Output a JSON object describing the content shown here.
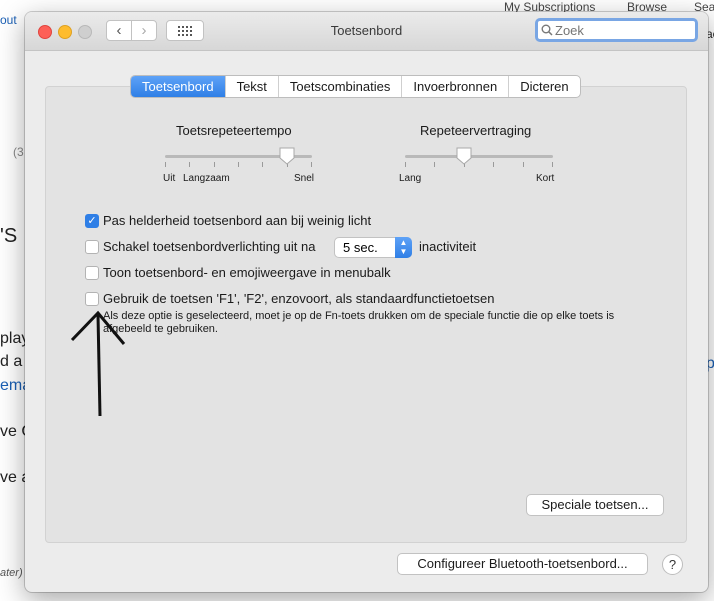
{
  "background": {
    "links_top": [
      "out",
      "My Subscriptions",
      "Browse",
      "Sea"
    ],
    "fragments": [
      "ac",
      "(3",
      "'S",
      "play",
      "d a",
      "ema",
      "ve C",
      "ve a",
      "ater)",
      "p"
    ]
  },
  "window": {
    "title": "Toetsenbord",
    "search_placeholder": "Zoek",
    "tabs": [
      "Toetsenbord",
      "Tekst",
      "Toetscombinaties",
      "Invoerbronnen",
      "Dicteren"
    ],
    "active_tab": 0,
    "key_repeat": {
      "label": "Toetsrepeteertempo",
      "left_label": "Uit",
      "left_label2": "Langzaam",
      "right_label": "Snel",
      "level": 0.83
    },
    "repeat_delay": {
      "label": "Repeteervertraging",
      "left_label": "Lang",
      "right_label": "Kort",
      "level": 0.4
    },
    "options": {
      "brightness": {
        "label": "Pas helderheid toetsenbord aan bij weinig licht",
        "checked": true
      },
      "backlight": {
        "label": "Schakel toetsenbordverlichting uit na",
        "checked": false,
        "select_value": "5 sec.",
        "suffix": "inactiviteit"
      },
      "menubar": {
        "label": "Toon toetsenbord- en emojiweergave in menubalk",
        "checked": false
      },
      "fkeys": {
        "label": "Gebruik de toetsen 'F1', 'F2', enzovoort, als standaardfunctietoetsen",
        "checked": false,
        "note_line1": "Als deze optie is geselecteerd, moet je op de Fn-toets drukken om de speciale functie die op elke toets is",
        "note_line2": "afgebeeld te gebruiken."
      }
    },
    "special_keys_button": "Speciale toetsen...",
    "bluetooth_button": "Configureer Bluetooth-toetsenbord...",
    "help_label": "?"
  },
  "colors": {
    "accent": "#2f7fe6",
    "close": "#fd5f57",
    "minimize": "#febc2e",
    "zoom": "#c8c8c8",
    "link": "#1a5fb4"
  }
}
